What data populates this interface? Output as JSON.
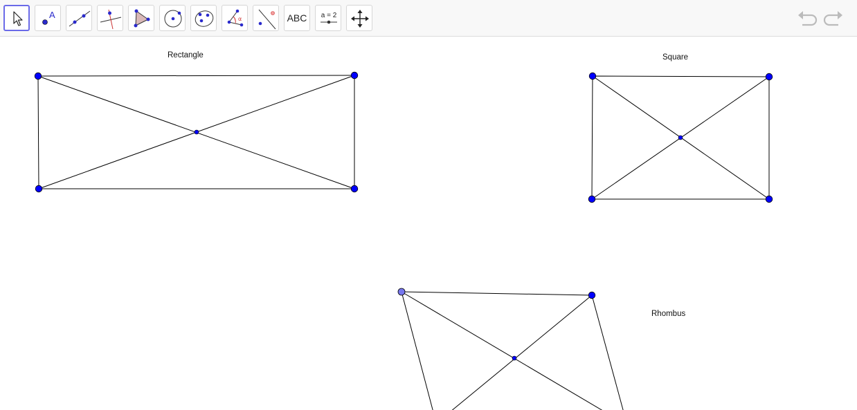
{
  "toolbar": {
    "tools": [
      {
        "name": "move-tool",
        "icon": "arrow-cursor-icon",
        "selected": true
      },
      {
        "name": "point-tool",
        "icon": "point-label-icon",
        "label": "A"
      },
      {
        "name": "line-tool",
        "icon": "line-through-points-icon"
      },
      {
        "name": "perpendicular-line-tool",
        "icon": "perpendicular-line-icon"
      },
      {
        "name": "polygon-tool",
        "icon": "polygon-icon"
      },
      {
        "name": "circle-tool",
        "icon": "circle-center-point-icon"
      },
      {
        "name": "conic-tool",
        "icon": "ellipse-icon"
      },
      {
        "name": "angle-tool",
        "icon": "angle-icon",
        "label": "α"
      },
      {
        "name": "reflect-tool",
        "icon": "reflect-about-line-icon"
      },
      {
        "name": "text-tool",
        "icon": "text-icon",
        "label": "ABC"
      },
      {
        "name": "slider-tool",
        "icon": "slider-icon",
        "label": "a = 2"
      },
      {
        "name": "move-graphics-view-tool",
        "icon": "move-arrows-icon"
      }
    ],
    "undo_icon": "undo-icon",
    "redo_icon": "redo-icon"
  },
  "colors": {
    "point_fill": "#0000ff",
    "point_selected_fill": "#7777ee",
    "point_stroke": "#000000",
    "segment": "#000000",
    "selected_border": "#6a6ae8",
    "undo_redo": "#bbbbbb"
  },
  "labels": {
    "rectangle": "Rectangle",
    "square": "Square",
    "rhombus": "Rhombus"
  }
}
